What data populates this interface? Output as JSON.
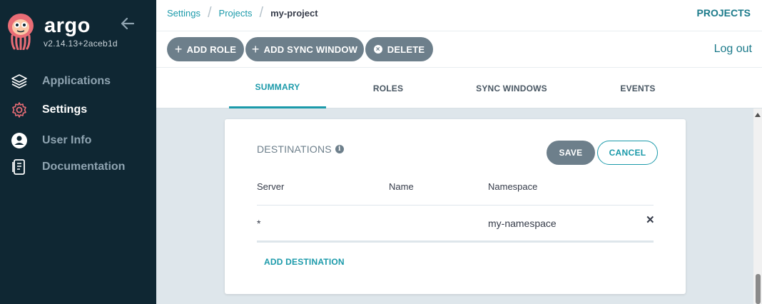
{
  "sidebar": {
    "brand": "argo",
    "version": "v2.14.13+2aceb1d",
    "items": [
      {
        "label": "Applications",
        "icon": "layers-icon"
      },
      {
        "label": "Settings",
        "icon": "gear-icon"
      },
      {
        "label": "User Info",
        "icon": "user-icon"
      },
      {
        "label": "Documentation",
        "icon": "book-icon"
      }
    ],
    "active_item": "Settings",
    "active_color": "#e96d76"
  },
  "breadcrumb": {
    "items": [
      "Settings",
      "Projects"
    ],
    "current": "my-project"
  },
  "header": {
    "projects_label": "PROJECTS",
    "logout_label": "Log out"
  },
  "toolbar": {
    "add_role": "ADD ROLE",
    "add_sync_window": "ADD SYNC WINDOW",
    "delete": "DELETE"
  },
  "tabs": [
    {
      "label": "SUMMARY",
      "active": true
    },
    {
      "label": "ROLES",
      "active": false
    },
    {
      "label": "SYNC WINDOWS",
      "active": false
    },
    {
      "label": "EVENTS",
      "active": false
    }
  ],
  "destinations": {
    "title": "DESTINATIONS",
    "save_label": "SAVE",
    "cancel_label": "CANCEL",
    "columns": [
      "Server",
      "Name",
      "Namespace"
    ],
    "rows": [
      {
        "server": "*",
        "name": "",
        "namespace": "my-namespace"
      }
    ],
    "add_label": "ADD DESTINATION"
  },
  "colors": {
    "sidebar_bg": "#0f2733",
    "accent": "#1b9aaa",
    "button_gray": "#6d7f8b",
    "page_bg": "#dee6eb"
  }
}
